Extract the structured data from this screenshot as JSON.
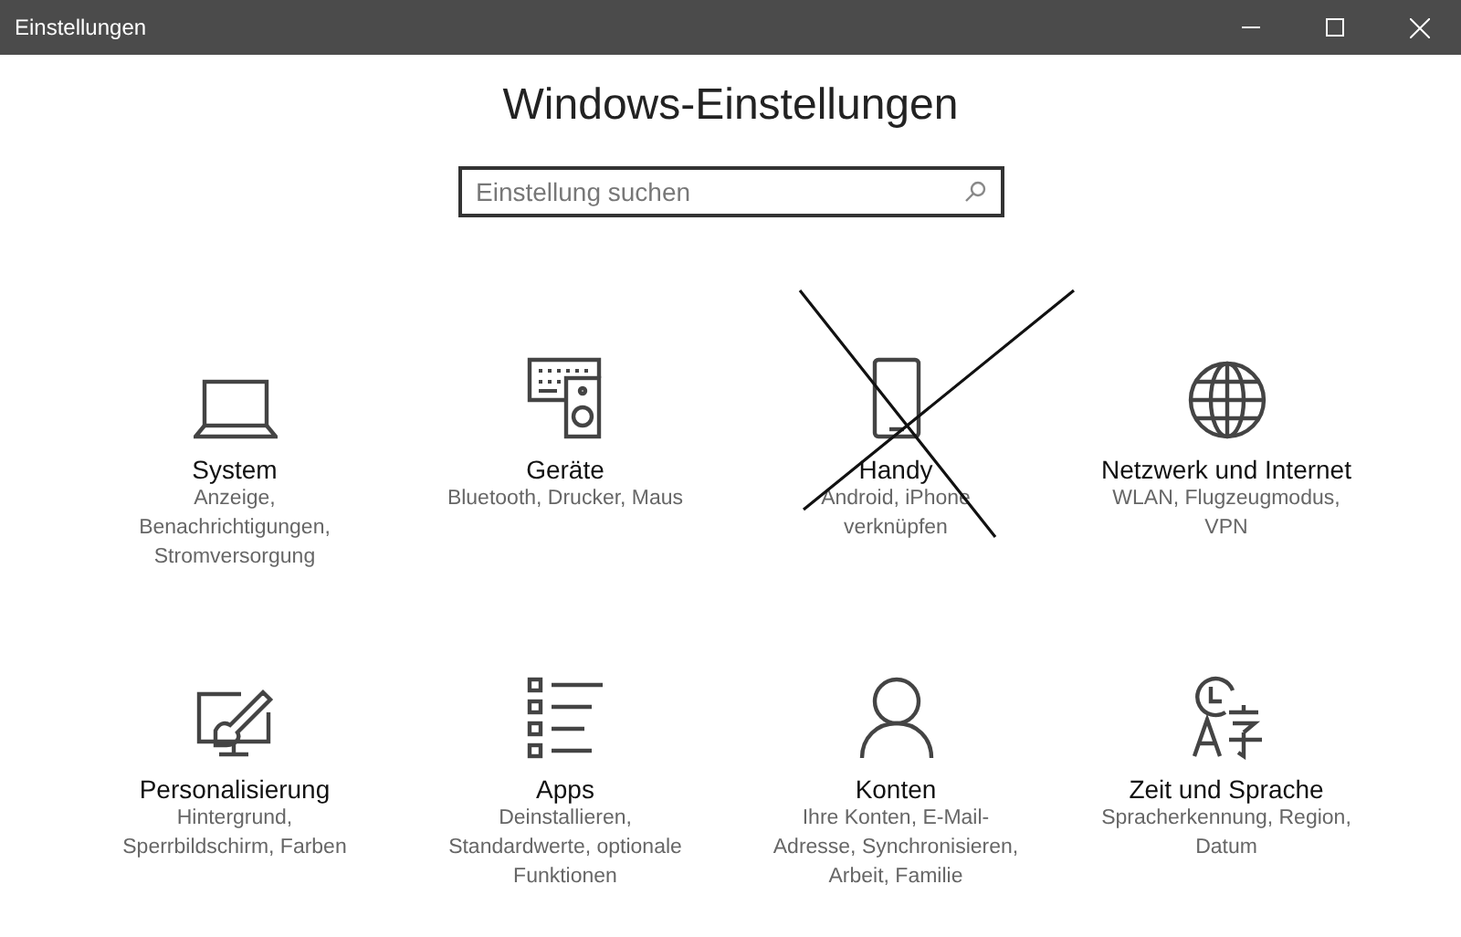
{
  "window": {
    "title": "Einstellungen"
  },
  "heading": "Windows-Einstellungen",
  "search": {
    "placeholder": "Einstellung suchen"
  },
  "tiles": [
    {
      "kind": "laptop",
      "title": "System",
      "lines": [
        "Anzeige,",
        "Benachrichtigungen,",
        "Stromversorgung"
      ],
      "crossed_out": false
    },
    {
      "kind": "devices",
      "title": "Geräte",
      "lines": [
        "Bluetooth, Drucker, Maus"
      ],
      "crossed_out": false
    },
    {
      "kind": "phone",
      "title": "Handy",
      "lines": [
        "Android, iPhone",
        "verknüpfen"
      ],
      "crossed_out": true
    },
    {
      "kind": "globe",
      "title": "Netzwerk und Internet",
      "lines": [
        "WLAN, Flugzeugmodus,",
        "VPN"
      ],
      "crossed_out": false
    },
    {
      "kind": "paint",
      "title": "Personalisierung",
      "lines": [
        "Hintergrund,",
        "Sperrbildschirm, Farben"
      ],
      "crossed_out": false
    },
    {
      "kind": "list",
      "title": "Apps",
      "lines": [
        "Deinstallieren,",
        "Standardwerte, optionale",
        "Funktionen"
      ],
      "crossed_out": false
    },
    {
      "kind": "person",
      "title": "Konten",
      "lines": [
        "Ihre Konten, E-Mail-",
        "Adresse, Synchronisieren,",
        "Arbeit, Familie"
      ],
      "crossed_out": false
    },
    {
      "kind": "language",
      "title": "Zeit und Sprache",
      "lines": [
        "Spracherkennung, Region,",
        "Datum"
      ],
      "crossed_out": false
    }
  ]
}
